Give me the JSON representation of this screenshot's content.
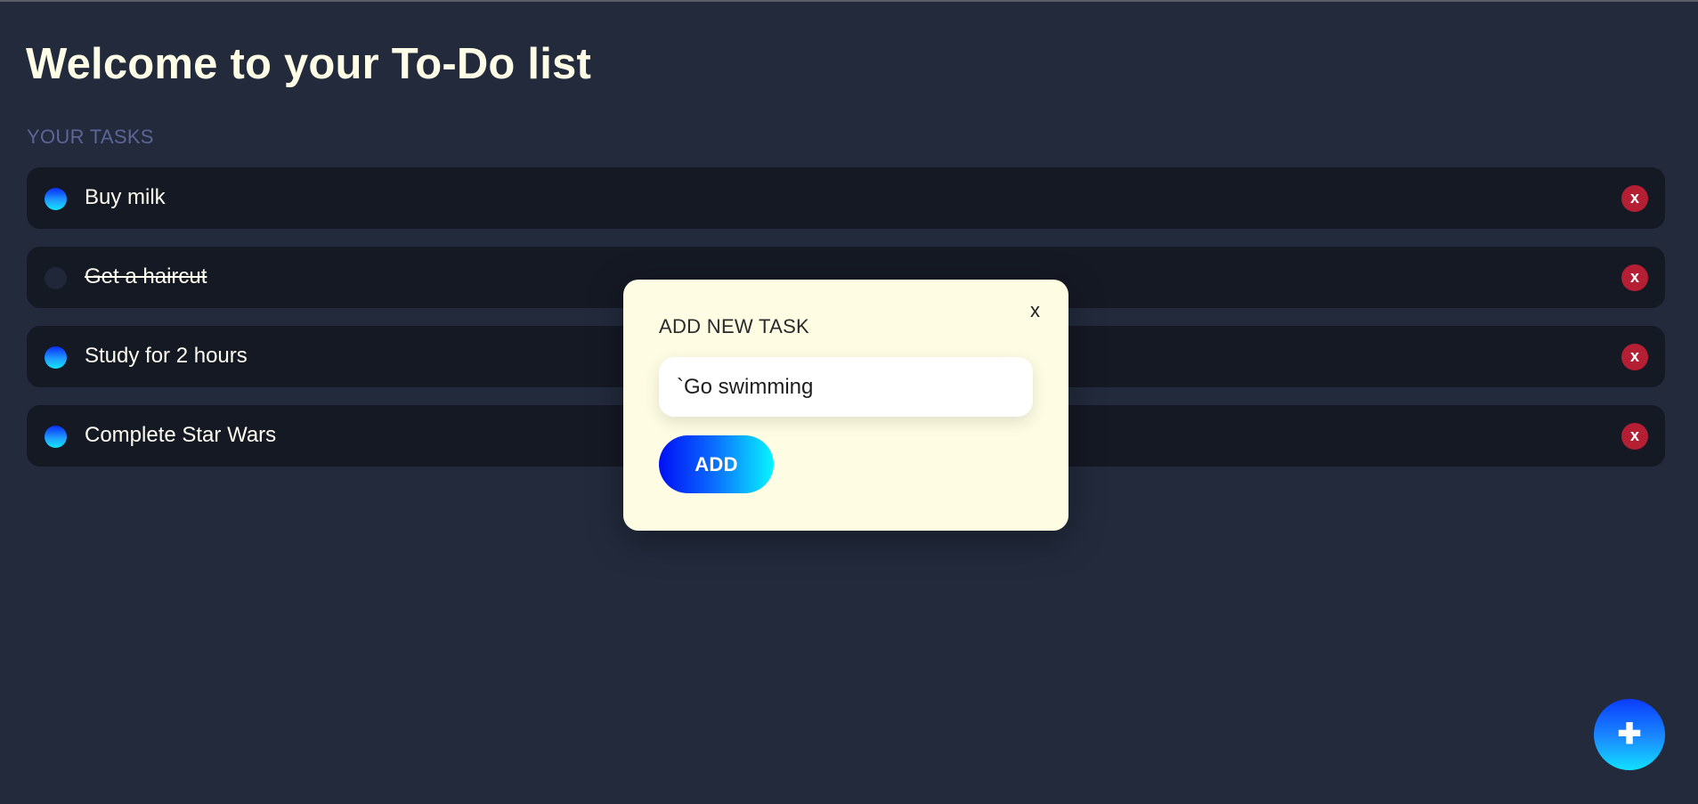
{
  "header": {
    "title": "Welcome to your To-Do list"
  },
  "tasks_section": {
    "label": "YOUR TASKS",
    "tasks": [
      {
        "text": "Buy milk",
        "done": false,
        "delete_label": "x"
      },
      {
        "text": "Get a haircut",
        "done": true,
        "delete_label": "x"
      },
      {
        "text": "Study for 2 hours",
        "done": false,
        "delete_label": "x"
      },
      {
        "text": "Complete Star Wars",
        "done": false,
        "delete_label": "x"
      }
    ]
  },
  "modal": {
    "title": "ADD NEW TASK",
    "close_label": "x",
    "input_value": "`Go swimming",
    "add_label": "ADD"
  },
  "fab": {
    "icon": "plus-icon",
    "label": "✚"
  },
  "colors": {
    "background": "#222a3c",
    "task_row": "#151924",
    "delete": "#b41f34",
    "modal": "#fefde4",
    "accent_start": "#0010f5",
    "accent_end": "#08f5ff"
  }
}
